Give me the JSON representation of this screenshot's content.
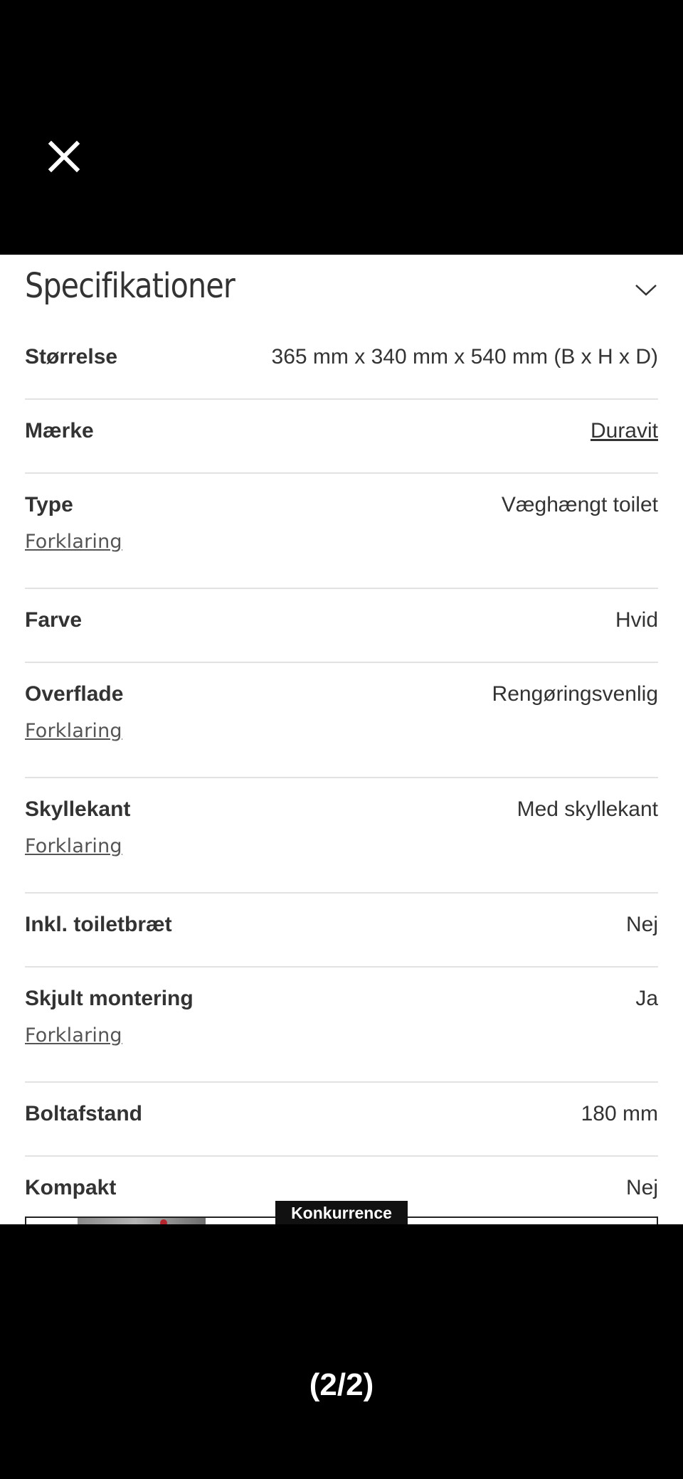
{
  "viewer": {
    "close_icon": "close-icon",
    "page_indicator": "(2/2)"
  },
  "section": {
    "title": "Specifikationer",
    "toggle_icon": "chevron-down-icon"
  },
  "specs": [
    {
      "label": "Størrelse",
      "value": "365 mm x 340 mm x 540 mm (B x H x D)"
    },
    {
      "label": "Mærke",
      "value": "Duravit"
    },
    {
      "label": "Type",
      "value": "Væghængt toilet",
      "explain": "Forklaring"
    },
    {
      "label": "Farve",
      "value": "Hvid"
    },
    {
      "label": "Overflade",
      "value": "Rengøringsvenlig",
      "explain": "Forklaring"
    },
    {
      "label": "Skyllekant",
      "value": "Med skyllekant",
      "explain": "Forklaring"
    },
    {
      "label": "Inkl. toiletbræt",
      "value": "Nej"
    },
    {
      "label": "Skjult montering",
      "value": "Ja",
      "explain": "Forklaring"
    },
    {
      "label": "Boltafstand",
      "value": "180 mm"
    },
    {
      "label": "Kompakt",
      "value": "Nej"
    }
  ],
  "ad": {
    "badge": "Konkurrence"
  },
  "colors": {
    "background": "#000000",
    "panel": "#ffffff",
    "text": "#333333",
    "divider": "#e2e2e2",
    "badge": "#111111"
  }
}
